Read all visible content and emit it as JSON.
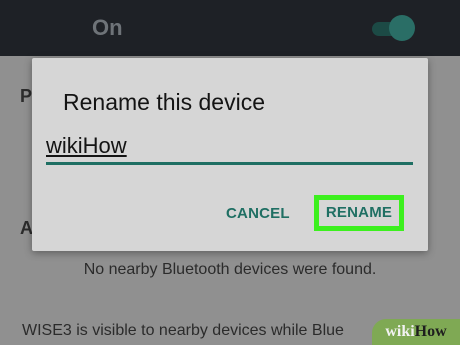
{
  "topbar": {
    "on_label": "On"
  },
  "background": {
    "frag_p": "P",
    "frag_a": "A",
    "frag_tick": "✓",
    "no_devices": "No nearby Bluetooth devices were found.",
    "visibility": "WISE3 is visible to nearby devices while Blue"
  },
  "dialog": {
    "title": "Rename this device",
    "input_value": "wikiHow",
    "cancel_label": "CANCEL",
    "rename_label": "RENAME"
  },
  "watermark": {
    "part1": "wiki",
    "part2": "How"
  },
  "colors": {
    "accent": "#1f6f63",
    "highlight": "#3cf01e"
  }
}
